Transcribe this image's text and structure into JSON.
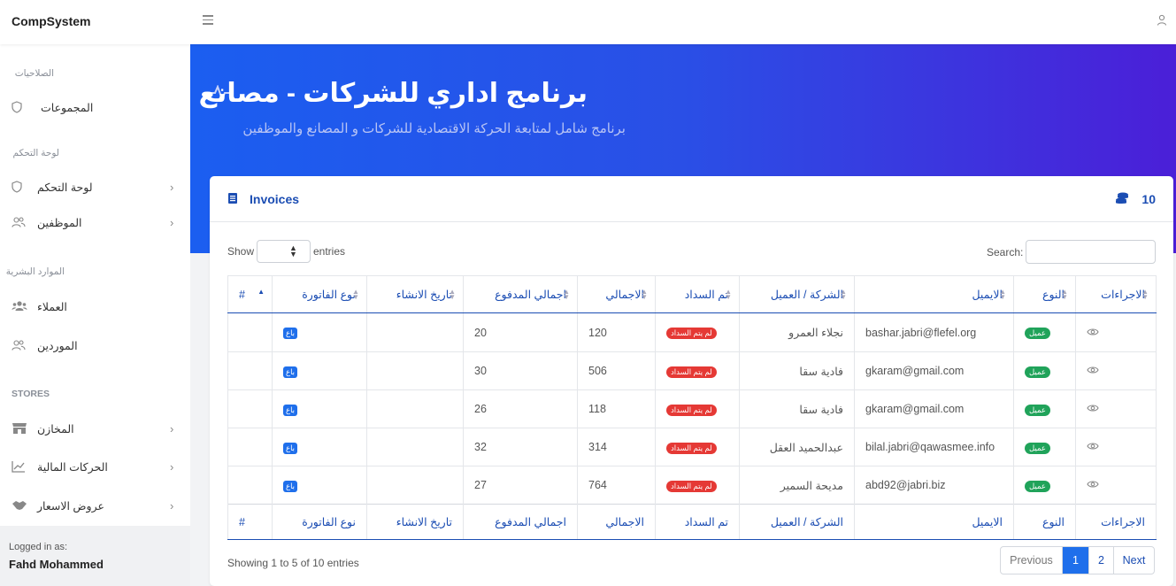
{
  "app": {
    "brand": "CompSystem"
  },
  "sidebar": {
    "sections": [
      {
        "title": "الصلاحيات"
      },
      {
        "title": "لوحة التحكم"
      },
      {
        "title": "الموارد البشرية"
      },
      {
        "title": "STORES"
      }
    ],
    "items": [
      {
        "label": "المجموعات",
        "icon": "shield-icon"
      },
      {
        "label": "لوحة التحكم",
        "icon": "shield-icon"
      },
      {
        "label": "الموظفين",
        "icon": "users-icon"
      },
      {
        "label": "العملاء",
        "icon": "users-filled-icon"
      },
      {
        "label": "الموردين",
        "icon": "users-icon"
      },
      {
        "label": "المخازن",
        "icon": "store-icon"
      },
      {
        "label": "الحركات المالية",
        "icon": "chart-icon"
      },
      {
        "label": "عروض الاسعار",
        "icon": "handshake-icon"
      }
    ],
    "logged_in_label": "Logged in as:",
    "user_name": "Fahd Mohammed"
  },
  "hero": {
    "title": "برنامج اداري للشركات - مصانع",
    "subtitle": "برنامج شامل لمتابعة الحركة الاقتصادية للشركات و المصانع والموظفين"
  },
  "card": {
    "title": "Invoices",
    "count": "10",
    "show_label": "Show",
    "entries_label": "entries",
    "search_label": "Search:",
    "search_value": "",
    "columns": [
      "#",
      "نوع الفاتورة",
      "تاريخ الانشاء",
      "اجمالي المدفوع",
      "الاجمالي",
      "تم السداد",
      "الشركة / العميل",
      "الايميل",
      "النوع",
      "الاجراءات"
    ],
    "rows": [
      {
        "type_badge": "باع",
        "created": "",
        "paid": "20",
        "total": "120",
        "status": "لم يتم السداد",
        "company": "نجلاء العمرو",
        "email": "bashar.jabri@flefel.org",
        "kind": "عميل"
      },
      {
        "type_badge": "باع",
        "created": "",
        "paid": "30",
        "total": "506",
        "status": "لم يتم السداد",
        "company": "فادية سقا",
        "email": "gkaram@gmail.com",
        "kind": "عميل"
      },
      {
        "type_badge": "باع",
        "created": "",
        "paid": "26",
        "total": "118",
        "status": "لم يتم السداد",
        "company": "فادية سقا",
        "email": "gkaram@gmail.com",
        "kind": "عميل"
      },
      {
        "type_badge": "باع",
        "created": "",
        "paid": "32",
        "total": "314",
        "status": "لم يتم السداد",
        "company": "عبدالحميد العقل",
        "email": "bilal.jabri@qawasmee.info",
        "kind": "عميل"
      },
      {
        "type_badge": "باع",
        "created": "",
        "paid": "27",
        "total": "764",
        "status": "لم يتم السداد",
        "company": "مديحة السمير",
        "email": "abd92@jabri.biz",
        "kind": "عميل"
      }
    ],
    "info": "Showing 1 to 5 of 10 entries",
    "pagination": {
      "previous": "Previous",
      "pages": [
        "1",
        "2"
      ],
      "next": "Next",
      "current": "1"
    }
  },
  "colors": {
    "accent": "#1f6feb",
    "heading": "#1b4db3",
    "status_red": "#e53935",
    "status_green": "#20a35a"
  }
}
